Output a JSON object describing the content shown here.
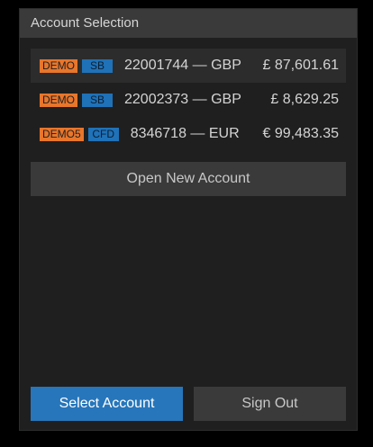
{
  "panel": {
    "title": "Account Selection"
  },
  "accounts": [
    {
      "env_tag": "DEMO",
      "type_tag": "SB",
      "label": "22001744 — GBP",
      "balance": "£ 87,601.61",
      "selected": true
    },
    {
      "env_tag": "DEMO",
      "type_tag": "SB",
      "label": "22002373 — GBP",
      "balance": "£ 8,629.25",
      "selected": false
    },
    {
      "env_tag": "DEMO5",
      "type_tag": "CFD",
      "label": "8346718 — EUR",
      "balance": "€ 99,483.35",
      "selected": false
    }
  ],
  "buttons": {
    "open_new_account": "Open New Account",
    "select_account": "Select Account",
    "sign_out": "Sign Out"
  },
  "colors": {
    "demo_tag": "#e8762b",
    "type_tag": "#1f72b8",
    "primary_button": "#2776bb"
  }
}
